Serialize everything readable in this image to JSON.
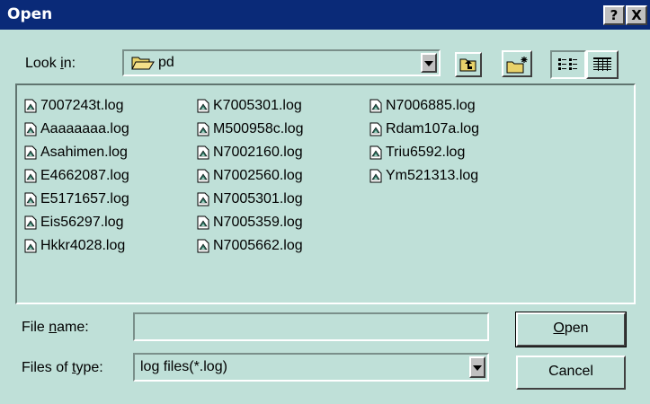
{
  "window": {
    "title": "Open",
    "help_button": "?",
    "close_button": "X"
  },
  "look_in": {
    "label_pre": "Look ",
    "label_u": "i",
    "label_post": "n:",
    "value": "pd"
  },
  "toolbar": {
    "up_icon": "up-folder-icon",
    "new_folder_icon": "new-folder-icon",
    "list_view_icon": "list-view-icon",
    "details_view_icon": "details-view-icon"
  },
  "files": {
    "columns": [
      [
        "7007243t.log",
        "Aaaaaaaa.log",
        "Asahimen.log",
        "E4662087.log",
        "E5171657.log",
        "Eis56297.log",
        "Hkkr4028.log"
      ],
      [
        "K7005301.log",
        "M500958c.log",
        "N7002160.log",
        "N7002560.log",
        "N7005301.log",
        "N7005359.log",
        "N7005662.log"
      ],
      [
        "N7006885.log",
        "Rdam107a.log",
        "Triu6592.log",
        "Ym521313.log"
      ]
    ]
  },
  "file_name": {
    "label_pre": "File ",
    "label_u": "n",
    "label_post": "ame:",
    "value": ""
  },
  "file_type": {
    "label_pre": "Files of ",
    "label_u": "t",
    "label_post": "ype:",
    "value": "log files(*.log)"
  },
  "buttons": {
    "open_u": "O",
    "open_rest": "pen",
    "cancel": "Cancel"
  }
}
